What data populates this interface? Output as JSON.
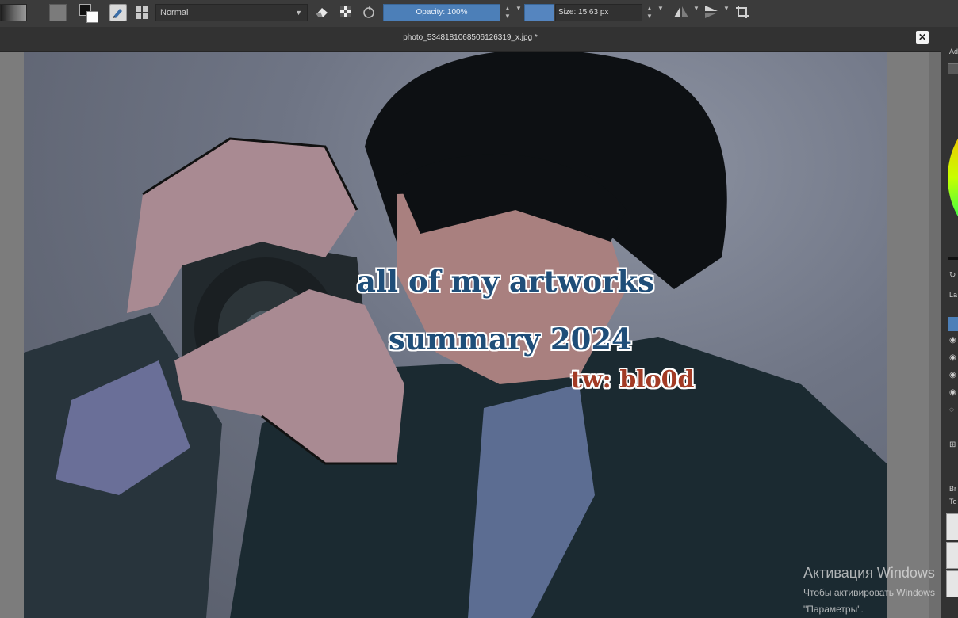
{
  "toolbar": {
    "blend_mode": "Normal",
    "opacity_label": "Opacity: 100%",
    "size_label": "Size: 15.63 px",
    "opacity_color": "#4c7fb8",
    "brush_color_swatch": "#5585bf",
    "icons": [
      "gradient-swatch",
      "pattern-swatch",
      "fg-bg-color",
      "brush-preset",
      "grid-toggle",
      "eraser-mode",
      "preserve-alpha",
      "reload-preset",
      "mirror-horizontal",
      "mirror-vertical",
      "wrap-around"
    ]
  },
  "document": {
    "title": "photo_5348181068506126319_x.jpg *"
  },
  "canvas_text": {
    "line1": "all of my artworks",
    "line2": "summary 2024",
    "line3": "tw: blo0d",
    "title_color": "#1f4e79",
    "warning_color": "#a33b25"
  },
  "docker": {
    "label_top": "Ad",
    "layers_label": "La",
    "brushes_label": "Br",
    "tags_label": "To"
  },
  "watermark": {
    "line1": "Активация Windows",
    "line2": "Чтобы активировать Windows",
    "line3": "\"Параметры\"."
  }
}
